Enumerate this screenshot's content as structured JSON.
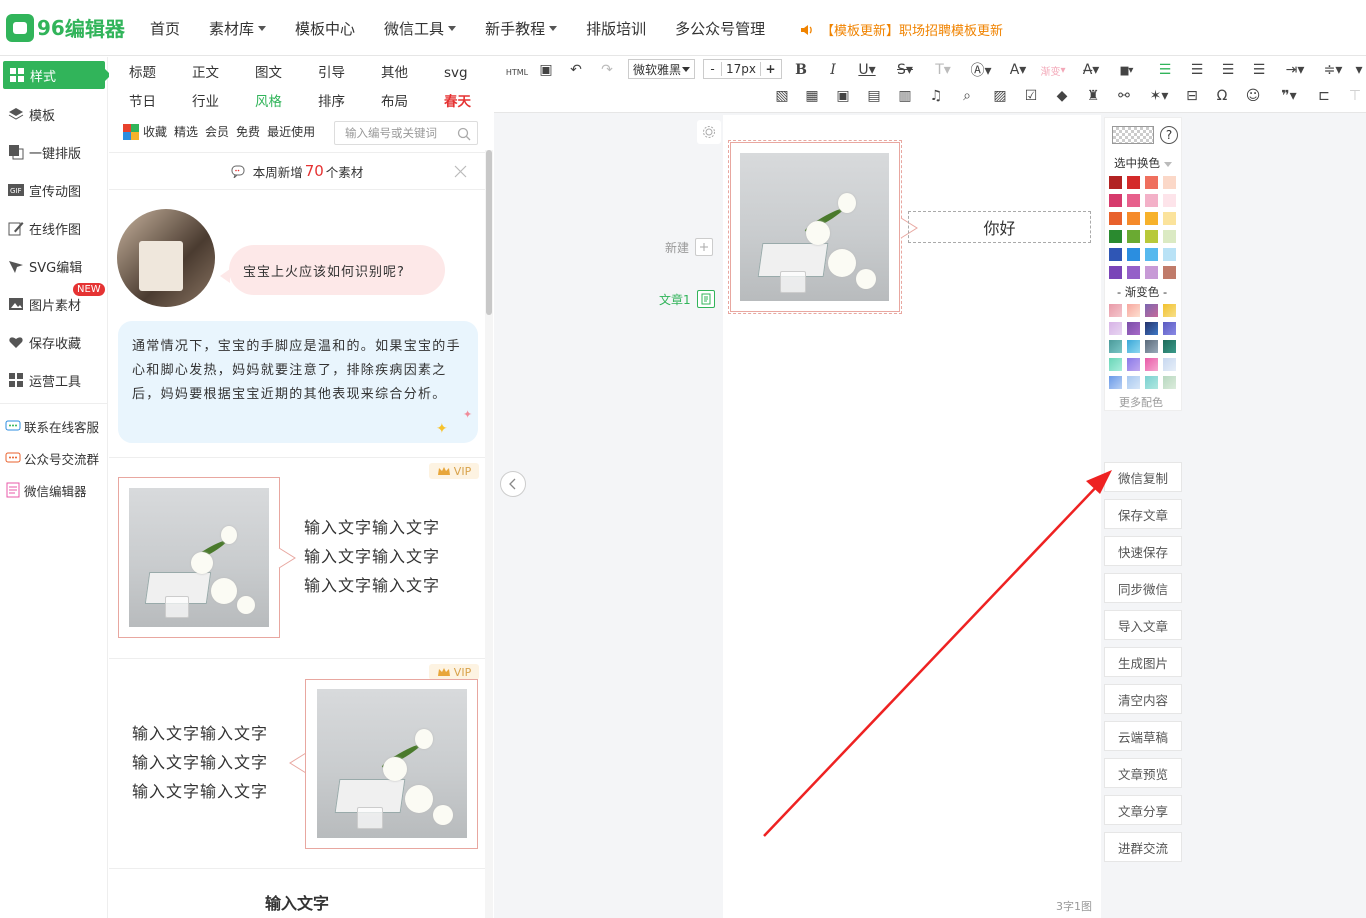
{
  "brand": {
    "number": "96",
    "name": "编辑器"
  },
  "nav": {
    "items": [
      {
        "label": "首页",
        "has_caret": false
      },
      {
        "label": "素材库",
        "has_caret": true
      },
      {
        "label": "模板中心",
        "has_caret": false
      },
      {
        "label": "微信工具",
        "has_caret": true
      },
      {
        "label": "新手教程",
        "has_caret": true
      },
      {
        "label": "排版培训",
        "has_caret": false
      },
      {
        "label": "多公众号管理",
        "has_caret": false
      }
    ],
    "notice": "【模板更新】职场招聘模板更新"
  },
  "sidebar": {
    "items": [
      {
        "label": "样式",
        "icon": "grid-icon",
        "active": true
      },
      {
        "label": "模板",
        "icon": "layers-icon"
      },
      {
        "label": "一键排版",
        "icon": "copy-icon"
      },
      {
        "label": "宣传动图",
        "icon": "gif-icon"
      },
      {
        "label": "在线作图",
        "icon": "edit-icon"
      },
      {
        "label": "SVG编辑",
        "icon": "cursor-icon"
      },
      {
        "label": "图片素材",
        "icon": "image-icon",
        "badge": "NEW"
      },
      {
        "label": "保存收藏",
        "icon": "heart-icon"
      },
      {
        "label": "运营工具",
        "icon": "grid-icon"
      }
    ],
    "links": [
      {
        "label": "联系在线客服",
        "icon": "chat-icon"
      },
      {
        "label": "公众号交流群",
        "icon": "group-icon"
      },
      {
        "label": "微信编辑器",
        "icon": "doc-icon"
      }
    ]
  },
  "categories": [
    "标题",
    "正文",
    "图文",
    "引导",
    "其他",
    "svg",
    "节日",
    "行业",
    "风格",
    "排序",
    "布局",
    "春天"
  ],
  "filters": [
    "收藏",
    "精选",
    "会员",
    "免费",
    "最近使用"
  ],
  "search": {
    "placeholder": "输入编号或关键词"
  },
  "newbar": {
    "prefix": "本周新增",
    "count": "70",
    "suffix": "个素材"
  },
  "materials": {
    "bubble_question": "宝宝上火应该如何识别呢?",
    "tip_text": "通常情况下，宝宝的手脚应是温和的。如果宝宝的手心和脚心发热，妈妈就要注意了，排除疾病因素之后，妈妈要根据宝宝近期的其他表现来综合分析。",
    "vip_label": "VIP",
    "card_lines": [
      "输入文字输入文字",
      "输入文字输入文字",
      "输入文字输入文字"
    ],
    "heading": "输入文字"
  },
  "toolbar": {
    "html_label": "HTML",
    "font": "微软雅黑",
    "size": "17px",
    "minus": "-",
    "plus": "+",
    "gradient_label": "渐变"
  },
  "editor": {
    "new_label": "新建",
    "article_label": "文章1",
    "hello_text": "你好",
    "word_count": "3字1图"
  },
  "palette": {
    "select_label": "选中换色",
    "gradient_label": "- 渐变色 -",
    "more_label": "更多配色",
    "solid_colors": [
      "#b22222",
      "#d42a2a",
      "#ef6f5e",
      "#fbd8c8",
      "#d63a6c",
      "#e7608c",
      "#f3b1c8",
      "#fde4ea",
      "#e8612c",
      "#f58a2a",
      "#f7b22b",
      "#fbe39c",
      "#2a8a2f",
      "#6aaa32",
      "#b8c93a",
      "#dbeac3",
      "#2f56b5",
      "#2b8ee0",
      "#57b9ee",
      "#b9e2f6",
      "#7a45b8",
      "#9460c8",
      "#c79ad6",
      "#c07b6a"
    ],
    "gradient_colors": [
      [
        "#e89aa8",
        "#f4c6cc"
      ],
      [
        "#f7a7a0",
        "#fde0d0"
      ],
      [
        "#7a66b0",
        "#c76a9a"
      ],
      [
        "#f2c12e",
        "#f7e08a"
      ],
      [
        "#d7b3e6",
        "#e8d6f2"
      ],
      [
        "#7a4ea8",
        "#a86ac8"
      ],
      [
        "#25326b",
        "#3e78c6"
      ],
      [
        "#5b5bc0",
        "#8a8ae6"
      ],
      [
        "#4a9a9a",
        "#7cc7c7"
      ],
      [
        "#3aa7d8",
        "#8fd8f0"
      ],
      [
        "#5a6a7a",
        "#9aaaba"
      ],
      [
        "#1f6b5b",
        "#3a9a8a"
      ],
      [
        "#6ad6b8",
        "#a8eedc"
      ],
      [
        "#8a7ae8",
        "#c0a8f0"
      ],
      [
        "#e85aa8",
        "#f6a8d0"
      ],
      [
        "#c8d8f0",
        "#e6eef8"
      ],
      [
        "#6a9ae8",
        "#b8d0f4"
      ],
      [
        "#a8c8f0",
        "#d6e6f8"
      ],
      [
        "#7ad0d0",
        "#b0e8e0"
      ],
      [
        "#b8d8c0",
        "#dcecdc"
      ]
    ]
  },
  "actions": [
    "微信复制",
    "保存文章",
    "快速保存",
    "同步微信",
    "导入文章",
    "生成图片",
    "清空内容",
    "云端草稿",
    "文章预览",
    "文章分享",
    "进群交流"
  ],
  "colors": {
    "brand_green": "#31b45a",
    "notice_orange": "#f08300",
    "accent_red": "#e53333",
    "annotation_arrow": "#ee2222"
  }
}
